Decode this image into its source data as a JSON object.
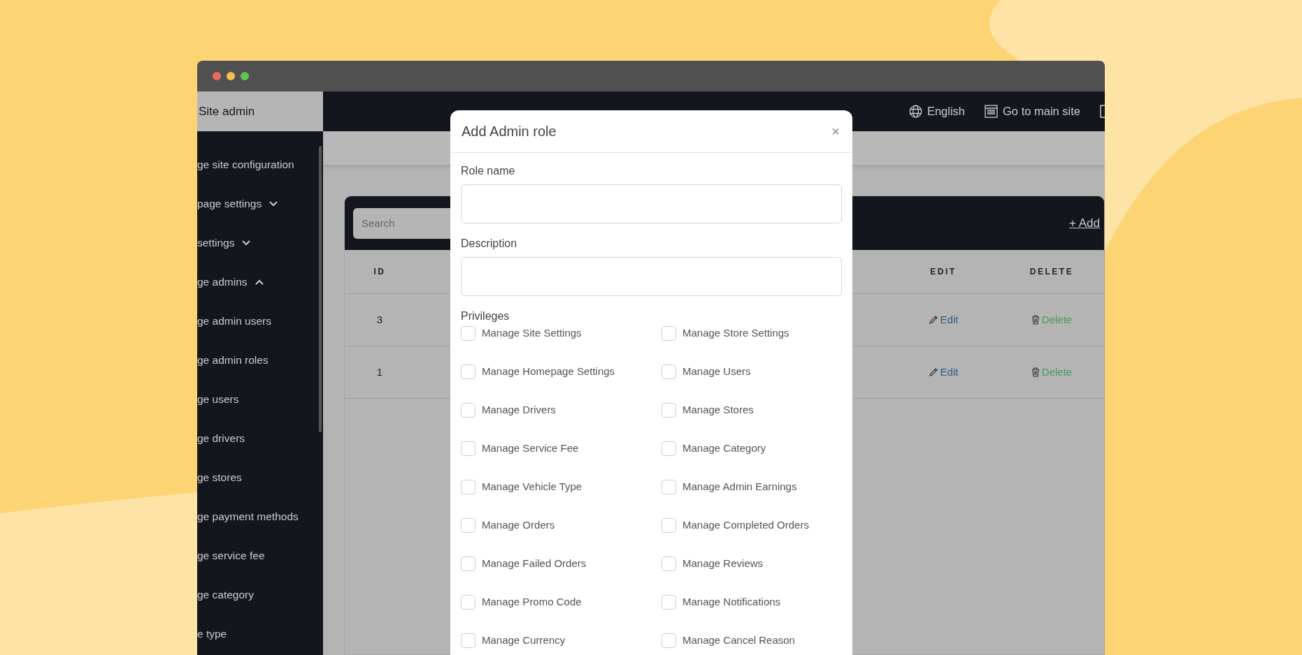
{
  "sidebar": {
    "brand": "Site admin",
    "items": [
      {
        "label": "ge site configuration",
        "kind": "link"
      },
      {
        "label": "page settings",
        "kind": "group",
        "expanded": false
      },
      {
        "label": "settings",
        "kind": "group",
        "expanded": false
      },
      {
        "label": "ge admins",
        "kind": "group",
        "expanded": true
      },
      {
        "label": "ge admin users",
        "kind": "link"
      },
      {
        "label": "ge admin roles",
        "kind": "link"
      },
      {
        "label": "ge users",
        "kind": "link"
      },
      {
        "label": "ge drivers",
        "kind": "link"
      },
      {
        "label": "ge stores",
        "kind": "link"
      },
      {
        "label": "ge payment methods",
        "kind": "link"
      },
      {
        "label": "ge service fee",
        "kind": "link"
      },
      {
        "label": "ge category",
        "kind": "link"
      },
      {
        "label": "e type",
        "kind": "link"
      }
    ]
  },
  "topbar": {
    "items": [
      {
        "kind": "language",
        "label": "English"
      },
      {
        "kind": "site",
        "label": "Go to main site"
      },
      {
        "kind": "logout"
      }
    ]
  },
  "table": {
    "search": {
      "placeholder": "Search"
    },
    "add_link": "+ Add",
    "columns": [
      "ID",
      "EDIT",
      "DELETE"
    ],
    "rows": [
      {
        "id": "3",
        "edit": "Edit",
        "delete": "Delete"
      },
      {
        "id": "1",
        "edit": "Edit",
        "delete": "Delete"
      }
    ]
  },
  "modal": {
    "title": "Add Admin role",
    "close": "×",
    "fields": [
      {
        "label": "Role name"
      },
      {
        "label": "Description"
      }
    ],
    "privileges_label": "Privileges",
    "privileges": [
      {
        "label": "Manage Site Settings",
        "checked": false
      },
      {
        "label": "Manage Store Settings",
        "checked": false
      },
      {
        "label": "Manage Homepage Settings",
        "checked": false
      },
      {
        "label": "Manage Users",
        "checked": false
      },
      {
        "label": "Manage Drivers",
        "checked": false
      },
      {
        "label": "Manage Stores",
        "checked": false
      },
      {
        "label": "Manage Service Fee",
        "checked": false
      },
      {
        "label": "Manage Category",
        "checked": false
      },
      {
        "label": "Manage Vehicle Type",
        "checked": false
      },
      {
        "label": "Manage Admin Earnings",
        "checked": false
      },
      {
        "label": "Manage Orders",
        "checked": false
      },
      {
        "label": "Manage Completed Orders",
        "checked": false
      },
      {
        "label": "Manage Failed Orders",
        "checked": false
      },
      {
        "label": "Manage Reviews",
        "checked": false
      },
      {
        "label": "Manage Promo Code",
        "checked": false
      },
      {
        "label": "Manage Notifications",
        "checked": false
      },
      {
        "label": "Manage Currency",
        "checked": false
      },
      {
        "label": "Manage Cancel Reason",
        "checked": false
      }
    ]
  }
}
